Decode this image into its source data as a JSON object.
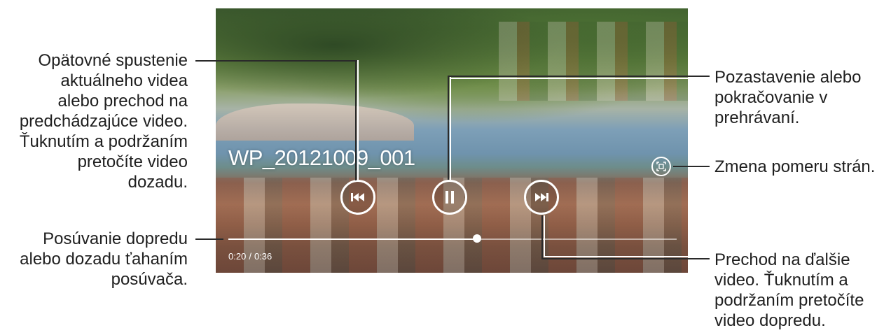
{
  "callouts": {
    "restart_previous": "Opätovné spustenie aktuálneho videa alebo prechod na predchádzajúce video. Ťuknutím a podržaním pretočíte video dozadu.",
    "restart_lines": [
      "Opätovné spustenie",
      "aktuálneho videa",
      "alebo prechod na",
      "predchádzajúce video.",
      "Ťuknutím a podržaním",
      "pretočíte video",
      "dozadu."
    ],
    "seek_lines": [
      "Posúvanie dopredu",
      "alebo dozadu ťahaním",
      "posúvača."
    ],
    "pause_lines": [
      "Pozastavenie alebo",
      "pokračovanie v",
      "prehrávaní."
    ],
    "ratio_lines": [
      "Zmena pomeru strán."
    ],
    "next_lines": [
      "Prechod na ďalšie",
      "video. Ťuknutím a",
      "podržaním pretočíte",
      "video dopredu."
    ]
  },
  "player": {
    "title": "WP_20121009_001",
    "current_time": "0:20",
    "separator": "/",
    "total_time": "0:36",
    "progress_fraction": 0.555
  },
  "icons": {
    "previous": "skip-previous-icon",
    "pause": "pause-icon",
    "next": "skip-next-icon",
    "aspect_ratio": "aspect-ratio-icon"
  },
  "colors": {
    "callout_text": "#1f1f1f",
    "leader_line": "#2a2a2a",
    "controls": "#ffffff"
  }
}
